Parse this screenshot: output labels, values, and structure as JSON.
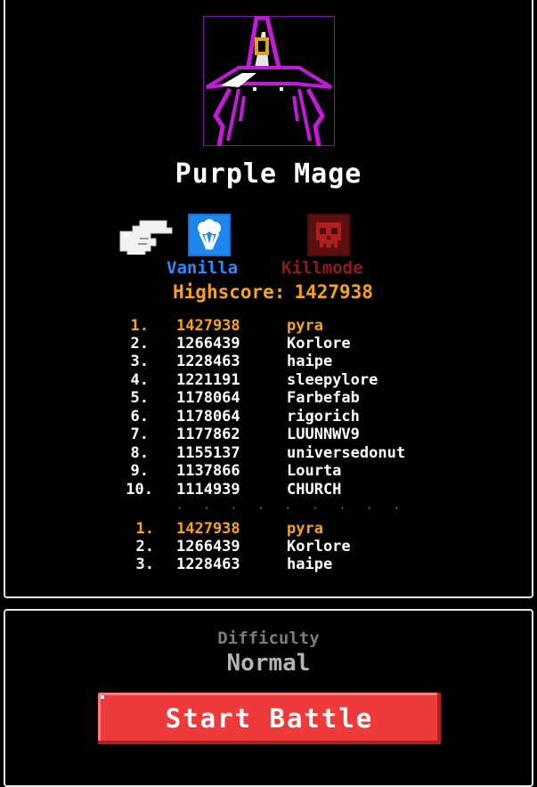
{
  "character": {
    "name": "Purple Mage",
    "portrait_icon": "purple-mage-wizard-icon"
  },
  "modes": {
    "selector_icon": "pointing-hand-icon",
    "vanilla": {
      "label": "Vanilla",
      "icon": "vanilla-ice-cream-icon",
      "color": "#2a8bff"
    },
    "killmode": {
      "label": "Killmode",
      "icon": "skull-icon",
      "color": "#8a1c1c"
    }
  },
  "highscore": {
    "label": "Highscore:",
    "value": "1427938"
  },
  "leaderboard": [
    {
      "rank": "1.",
      "score": "1427938",
      "name": "pyra"
    },
    {
      "rank": "2.",
      "score": "1266439",
      "name": "Korlore"
    },
    {
      "rank": "3.",
      "score": "1228463",
      "name": "haipe"
    },
    {
      "rank": "4.",
      "score": "1221191",
      "name": "sleepylore"
    },
    {
      "rank": "5.",
      "score": "1178064",
      "name": "Farbefab"
    },
    {
      "rank": "6.",
      "score": "1178064",
      "name": "rigorich"
    },
    {
      "rank": "7.",
      "score": "1177862",
      "name": "LUUNNWV9"
    },
    {
      "rank": "8.",
      "score": "1155137",
      "name": "universedonut"
    },
    {
      "rank": "9.",
      "score": "1137866",
      "name": "Lourta"
    },
    {
      "rank": "10.",
      "score": "1114939",
      "name": "CHURCH"
    }
  ],
  "separator": "· · · · · · · · ·",
  "personal": [
    {
      "rank": "1.",
      "score": "1427938",
      "name": "pyra"
    },
    {
      "rank": "2.",
      "score": "1266439",
      "name": "Korlore"
    },
    {
      "rank": "3.",
      "score": "1228463",
      "name": "haipe"
    }
  ],
  "difficulty": {
    "caption": "Difficulty",
    "value": "Normal"
  },
  "start_button": {
    "label": "Start Battle"
  },
  "colors": {
    "highlight": "#f7a21c",
    "button": "#ee3a3a",
    "wizard": "#c21ad6"
  }
}
